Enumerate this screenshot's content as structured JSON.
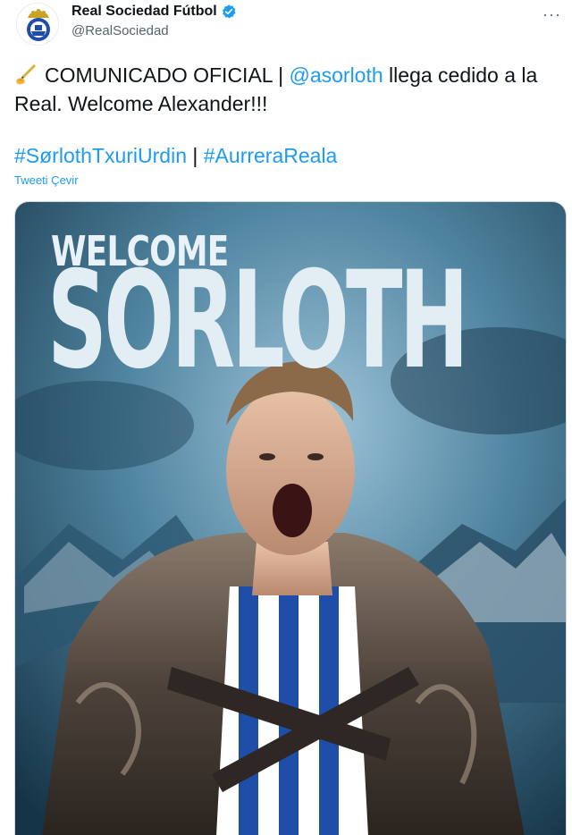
{
  "author": {
    "name": "Real Sociedad Fútbol",
    "handle": "@RealSociedad",
    "verified": true,
    "avatar_icon": "real-sociedad-crest"
  },
  "menu": {
    "more_icon": "more-dots-icon",
    "more_label": "···"
  },
  "tweet": {
    "emoji": "writing-hand-icon",
    "text_part1": "COMUNICADO OFICIAL | ",
    "mention": "@asorloth",
    "text_part2": " llega cedido a la Real. Welcome Alexander!!!",
    "hashtag1": "#SørlothTxuriUrdin",
    "separator": " | ",
    "hashtag2": "#AurreraReala",
    "translate_label": "Tweeti Çevir"
  },
  "media": {
    "headline_small": "WELCOME",
    "headline_large": "SORLOTH"
  },
  "colors": {
    "link": "#1d9bf0",
    "text": "#0f1419",
    "secondary": "#536471",
    "kit_blue": "#1f4ea8"
  }
}
